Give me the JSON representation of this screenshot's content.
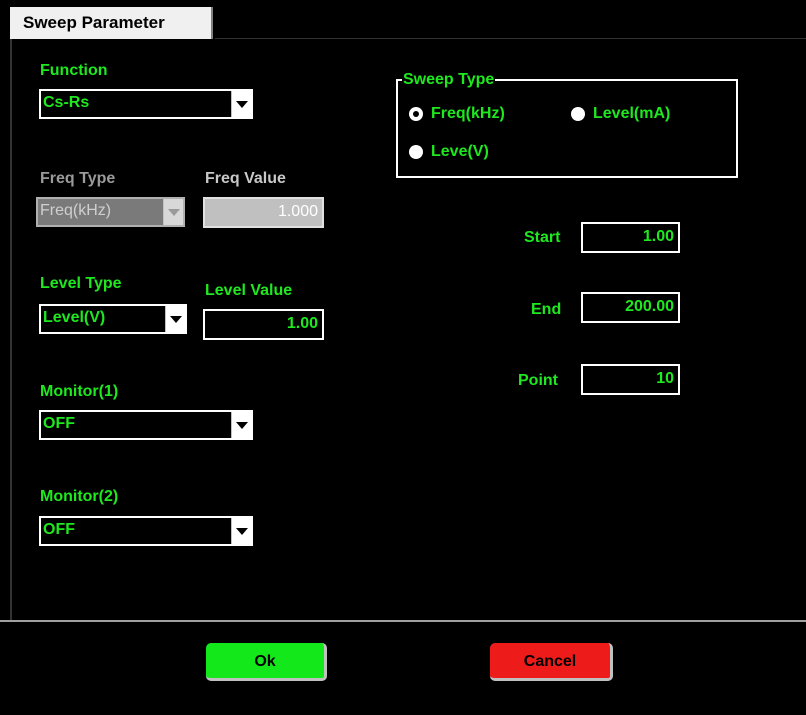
{
  "tab": {
    "label": "Sweep Parameter"
  },
  "function": {
    "label": "Function",
    "value": "Cs-Rs"
  },
  "freq": {
    "type_label": "Freq Type",
    "type_value": "Freq(kHz)",
    "value_label": "Freq Value",
    "value": "1.000"
  },
  "level": {
    "type_label": "Level Type",
    "type_value": "Level(V)",
    "value_label": "Level Value",
    "value": "1.00"
  },
  "monitor1": {
    "label": "Monitor(1)",
    "value": "OFF"
  },
  "monitor2": {
    "label": "Monitor(2)",
    "value": "OFF"
  },
  "sweep_type": {
    "legend": "Sweep Type",
    "options": [
      "Freq(kHz)",
      "Level(mA)",
      "Leve(V)"
    ],
    "selected": "Freq(kHz)"
  },
  "start": {
    "label": "Start",
    "value": "1.00"
  },
  "end": {
    "label": "End",
    "value": "200.00"
  },
  "point": {
    "label": "Point",
    "value": "10"
  },
  "buttons": {
    "ok": "Ok",
    "cancel": "Cancel"
  },
  "colors": {
    "label_green": "#1ee81e",
    "ok_green": "#13e81a",
    "cancel_red": "#ee1b1b",
    "background": "#000000"
  }
}
